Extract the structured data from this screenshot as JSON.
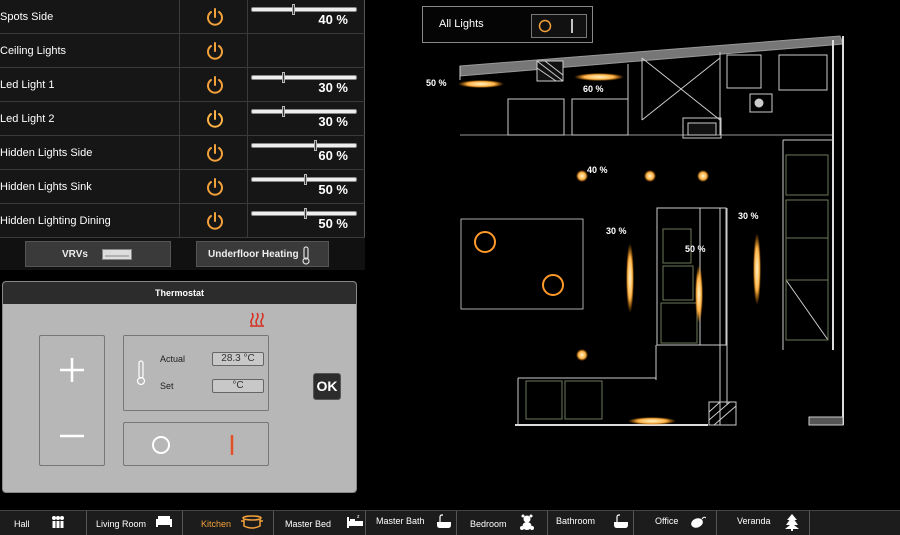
{
  "lights": [
    {
      "name": "Spots Side",
      "value": "40 %",
      "level": 0.4
    },
    {
      "name": "Ceiling Lights",
      "value": "",
      "level": null
    },
    {
      "name": "Led Light 1",
      "value": "30 %",
      "level": 0.3
    },
    {
      "name": "Led Light 2",
      "value": "30 %",
      "level": 0.3
    },
    {
      "name": "Hidden Lights Side",
      "value": "60 %",
      "level": 0.6
    },
    {
      "name": "Hidden Lights Sink",
      "value": "50 %",
      "level": 0.5
    },
    {
      "name": "Hidden Lighting Dining",
      "value": "50 %",
      "level": 0.5
    }
  ],
  "panel_buttons": {
    "vrvs": "VRVs",
    "underfloor": "Underfloor Heating"
  },
  "thermostat": {
    "title": "Thermostat",
    "actual_label": "Actual",
    "actual_value": "28.3 °C",
    "set_label": "Set",
    "set_value": "°C",
    "ok_label": "OK"
  },
  "all_lights": {
    "label": "All Lights"
  },
  "floorplan_labels": {
    "left_strip": "50 %",
    "top_strip": "60 %",
    "spots": "40 %",
    "led1": "30 %",
    "center": "50 %",
    "right_led": "30 %"
  },
  "nav": [
    {
      "label": "Hall",
      "icon": "people-icon"
    },
    {
      "label": "Living Room",
      "icon": "sofa-icon"
    },
    {
      "label": "Kitchen",
      "icon": "pot-icon",
      "active": true
    },
    {
      "label": "Master Bed",
      "icon": "bed-icon"
    },
    {
      "label": "Master Bath",
      "icon": "bathtub-icon"
    },
    {
      "label": "Bedroom",
      "icon": "teddy-bear-icon"
    },
    {
      "label": "Bathroom",
      "icon": "bathtub-icon"
    },
    {
      "label": "Office",
      "icon": "mouse-icon"
    },
    {
      "label": "Veranda",
      "icon": "tree-icon"
    }
  ],
  "colors": {
    "accent": "#f3a13b",
    "glow": "#ffb347",
    "panel": "#161616",
    "thermo_bg": "#b7b7b7"
  }
}
